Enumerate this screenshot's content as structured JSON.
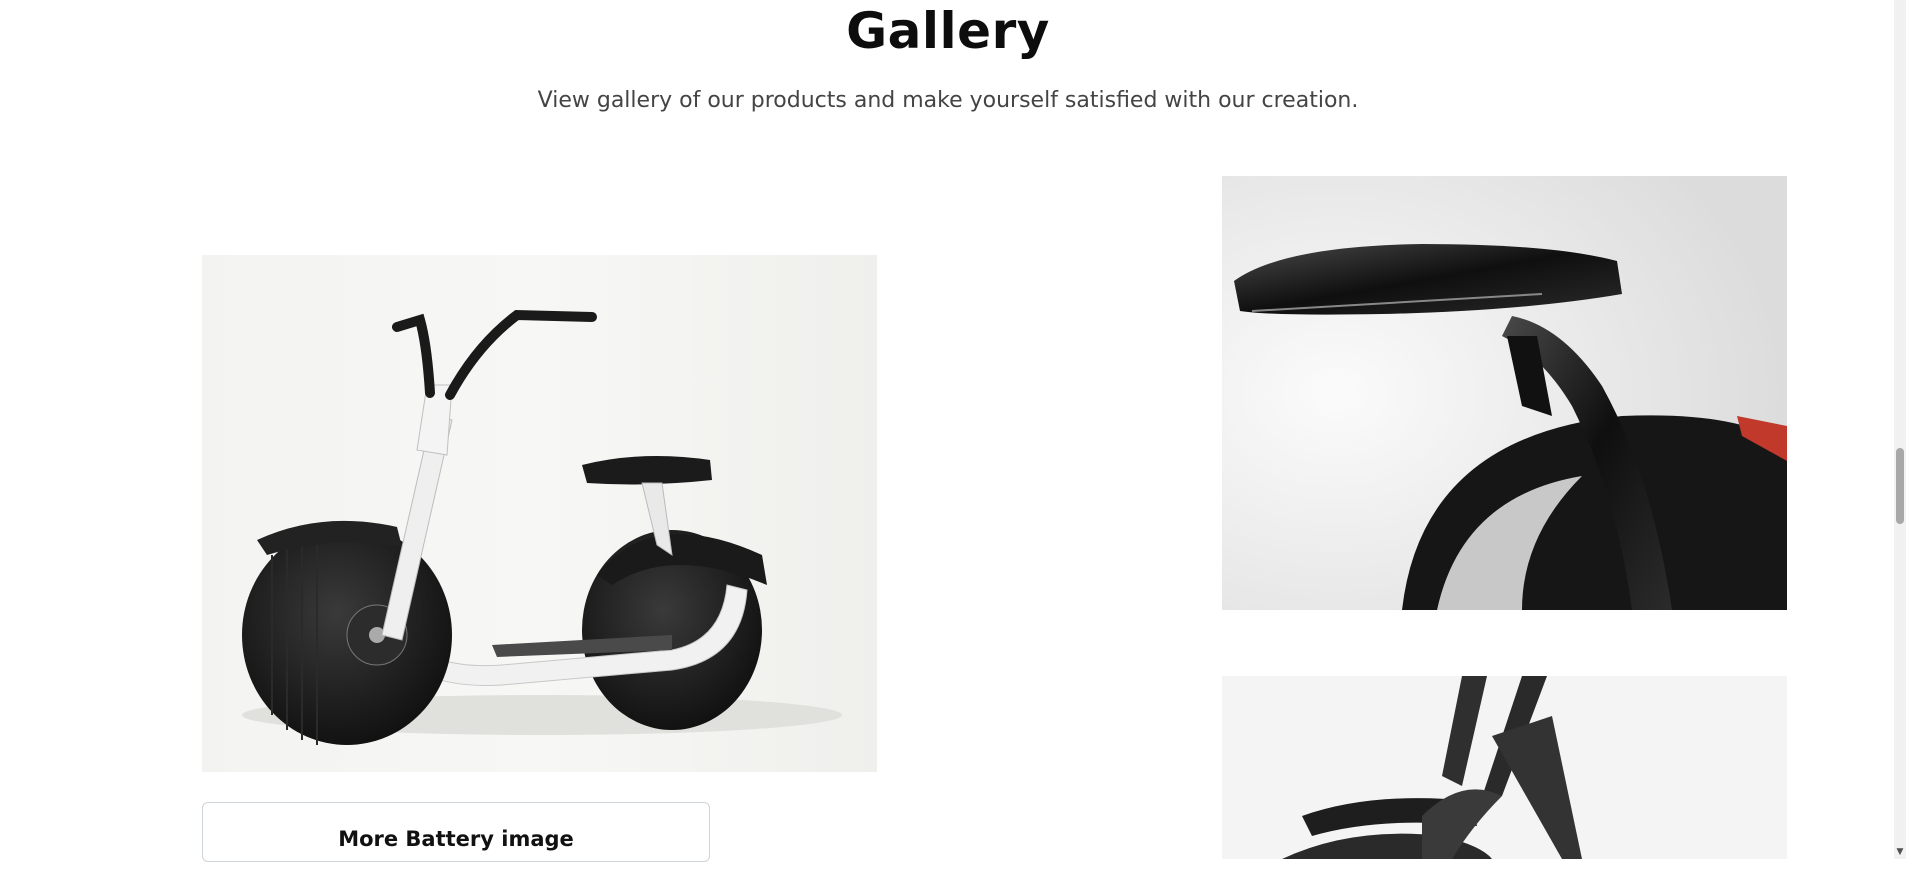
{
  "gallery": {
    "title": "Gallery",
    "subtitle": "View gallery of our products and make yourself satisfied with our creation.",
    "images": [
      {
        "name": "scooter-side-view"
      },
      {
        "name": "scooter-seat-closeup"
      },
      {
        "name": "scooter-frame-closeup"
      }
    ],
    "more_button_label": "More Battery image"
  },
  "scrollbar": {
    "arrow_icon": "chevron-down-icon"
  }
}
